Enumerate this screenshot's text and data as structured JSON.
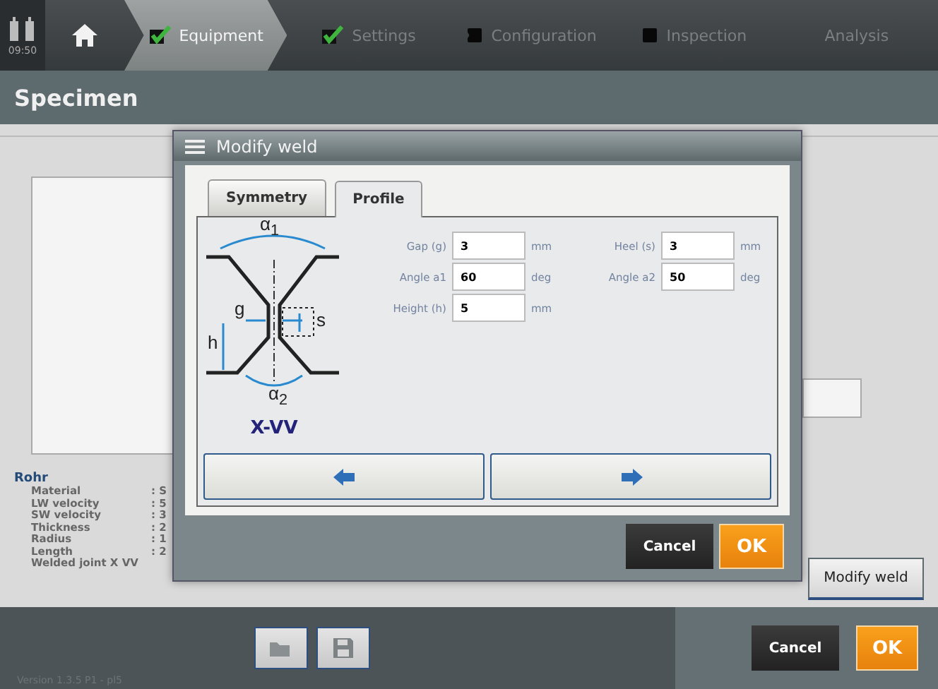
{
  "status": {
    "time": "09:50"
  },
  "steps": [
    {
      "label": "Equipment",
      "kind": "done",
      "selected": true
    },
    {
      "label": "Settings",
      "kind": "done",
      "selected": false
    },
    {
      "label": "Configuration",
      "kind": "todo",
      "selected": false
    },
    {
      "label": "Inspection",
      "kind": "todo",
      "selected": false
    },
    {
      "label": "Analysis",
      "kind": "plain",
      "selected": false
    }
  ],
  "header": {
    "title": "Specimen"
  },
  "specimen": {
    "title": "Rohr",
    "properties": [
      {
        "label": "Material",
        "value": ": S"
      },
      {
        "label": "LW velocity",
        "value": ": 5"
      },
      {
        "label": "SW velocity",
        "value": ": 3"
      },
      {
        "label": "Thickness",
        "value": ": 2"
      },
      {
        "label": "Radius",
        "value": ": 1"
      },
      {
        "label": "Length",
        "value": ": 2"
      },
      {
        "label": "Welded joint X VV"
      }
    ]
  },
  "side_button": "Modify weld",
  "dialog": {
    "title": "Modify weld",
    "tabs": [
      {
        "label": "Symmetry",
        "selected": false
      },
      {
        "label": "Profile",
        "selected": true
      }
    ],
    "diagram_labels": {
      "alpha1": "α$_{1}$",
      "alpha2": "α$_{2}$",
      "gap": "g",
      "heel": "s",
      "height": "h"
    },
    "weld_type": "X-VV",
    "fields": [
      {
        "label": "Gap (g)",
        "value": "3",
        "unit": "mm"
      },
      {
        "label": "Heel (s)",
        "value": "3",
        "unit": "mm"
      },
      {
        "label": "Angle a1",
        "value": "60",
        "unit": "deg"
      },
      {
        "label": "Angle a2",
        "value": "50",
        "unit": "deg"
      },
      {
        "label": "Height (h)",
        "value": "5",
        "unit": "mm"
      }
    ],
    "buttons": [
      {
        "label": "Cancel",
        "kind": "secondary"
      },
      {
        "label": "OK",
        "kind": "primary"
      }
    ]
  },
  "footer": {
    "version": "Version 1.3.5 P1 - pl5",
    "buttons": [
      {
        "label": "Cancel",
        "kind": "secondary"
      },
      {
        "label": "OK",
        "kind": "primary"
      }
    ]
  }
}
